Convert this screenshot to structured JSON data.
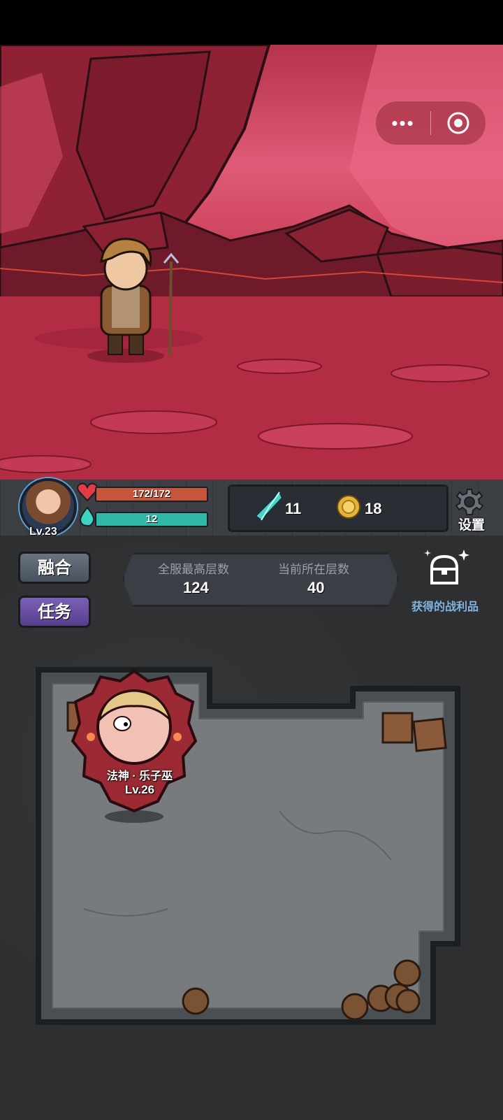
{
  "scene": {
    "description_icon": "wizard-character-icon"
  },
  "capsule": {
    "more_label": "•••",
    "close_icon": "target-circle-icon"
  },
  "player": {
    "level": "Lv.23",
    "hp": "172/172",
    "hp_fraction": 1.0,
    "mp": "12",
    "mp_fraction": 1.0
  },
  "resources": {
    "crystal": "11",
    "coin": "18"
  },
  "settings": {
    "label": "设置"
  },
  "buttons": {
    "fuse": "融合",
    "task": "任务"
  },
  "floors": {
    "server_max_label": "全服最高层数",
    "server_max_value": "124",
    "current_label": "当前所在层数",
    "current_value": "40"
  },
  "loot": {
    "label": "获得的战利品"
  },
  "hero": {
    "name": "法神 · 乐子巫",
    "level": "Lv.26"
  },
  "colors": {
    "hp": "#c4573b",
    "mp": "#2fb7a8",
    "fuse_btn": "#5a6470",
    "task_btn": "#6a4fa0",
    "loot_label": "#7fb4e0"
  }
}
